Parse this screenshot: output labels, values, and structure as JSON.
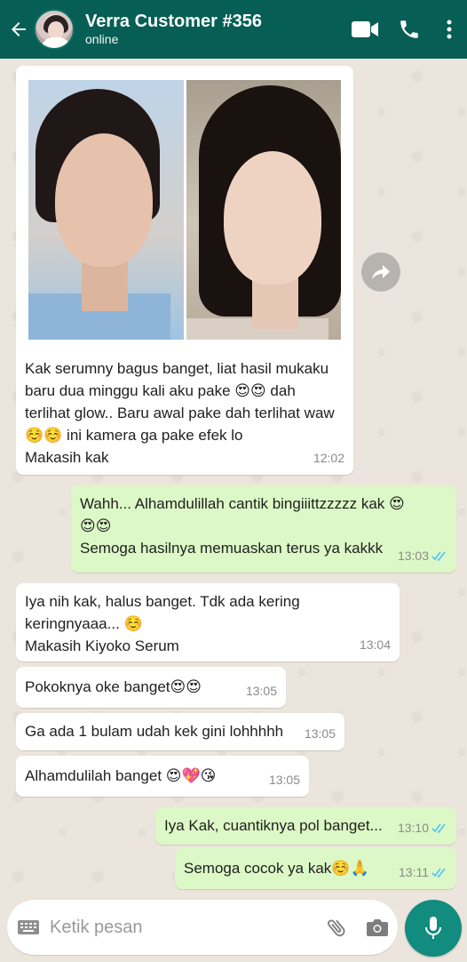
{
  "header": {
    "contact_name": "Verra Customer #356",
    "status": "online"
  },
  "messages": [
    {
      "direction": "in",
      "type": "image-with-caption",
      "lines": [
        "Kak serumny  bagus banget, liat hasil mukaku",
        "baru dua minggu kali aku pake 😍😍 dah",
        "terlihat glow.. Baru awal pake dah terlihat waw",
        "☺️☺️ ini kamera ga pake efek lo",
        "Makasih kak"
      ],
      "time": "12:02"
    },
    {
      "direction": "out",
      "lines": [
        "Wahh... Alhamdulillah cantik bingiiittzzzzz kak 😍",
        "😍😍",
        "Semoga hasilnya memuaskan terus ya kakkk"
      ],
      "time": "13:03"
    },
    {
      "direction": "in",
      "lines": [
        "Iya nih kak, halus banget. Tdk ada kering",
        "keringnyaaa... ☺️",
        "Makasih Kiyoko Serum"
      ],
      "time": "13:04"
    },
    {
      "direction": "in",
      "lines": [
        "Pokoknya oke banget😍😍"
      ],
      "time": "13:05"
    },
    {
      "direction": "in",
      "lines": [
        "Ga ada 1 bulam udah kek gini lohhhhh"
      ],
      "time": "13:05"
    },
    {
      "direction": "in",
      "lines": [
        "Alhamdulilah banget 😍💖😘"
      ],
      "time": "13:05"
    },
    {
      "direction": "out",
      "lines": [
        "Iya Kak, cuantiknya pol banget..."
      ],
      "time": "13:10"
    },
    {
      "direction": "out",
      "lines": [
        "Semoga cocok ya kak☺️🙏"
      ],
      "time": "13:11"
    }
  ],
  "composer": {
    "placeholder": "Ketik pesan"
  },
  "colors": {
    "header": "#075e54",
    "outgoing_bubble": "#dcf8c6",
    "incoming_bubble": "#ffffff",
    "mic_button": "#128c7e",
    "read_ticks": "#4fc3f7"
  }
}
